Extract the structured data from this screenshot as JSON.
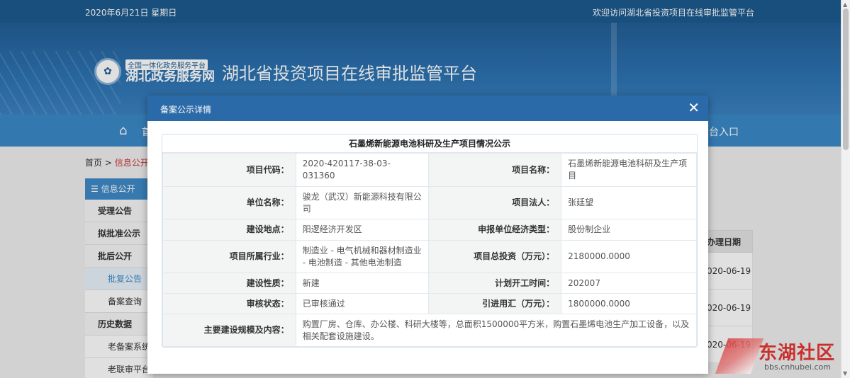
{
  "topbar": {
    "date": "2020年6月21日   星期日",
    "welcome": "欢迎访问湖北省投资项目在线审批监管平台"
  },
  "banner": {
    "gov_small": "全国一体化政务服务平台",
    "gov_big": "湖北政务服务网",
    "site_title": "湖北省投资项目在线审批监管平台"
  },
  "nav": {
    "home_icon": "home-icon",
    "home_text": "首",
    "entry_text": "台入口"
  },
  "breadcrumb": {
    "home": "首页",
    "sep": " > ",
    "current": "信息公开"
  },
  "sidebar": {
    "header": "信息公开",
    "items": [
      {
        "label": "受理公告"
      },
      {
        "label": "拟批准公示"
      },
      {
        "label": "批后公开"
      },
      {
        "label": "批复公告"
      },
      {
        "label": "备案查询"
      },
      {
        "label": "历史数据"
      },
      {
        "label": "老备案系统"
      },
      {
        "label": "老联审平台"
      }
    ]
  },
  "right_table": {
    "header": "办理日期",
    "rows": [
      "020-06-19",
      "020-06-19",
      "020-06-19"
    ]
  },
  "modal": {
    "title": "备案公示详情",
    "close_icon": "close-icon",
    "table_title": "石墨烯新能源电池科研及生产项目情况公示",
    "rows": [
      {
        "l1": "项目代码：",
        "v1": "2020-420117-38-03-031360",
        "l2": "项目名称：",
        "v2": "石墨烯新能源电池科研及生产项目"
      },
      {
        "l1": "单位名称：",
        "v1": "骏龙（武汉）新能源科技有限公司",
        "l2": "项目法人：",
        "v2": "张廷望"
      },
      {
        "l1": "建设地点：",
        "v1": "阳逻经济开发区",
        "l2": "申报单位经济类型：",
        "v2": "股份制企业"
      },
      {
        "l1": "项目所属行业：",
        "v1": "制造业 - 电气机械和器材制造业 - 电池制造 - 其他电池制造",
        "l2": "项目总投资（万元）：",
        "v2": "2180000.0000"
      },
      {
        "l1": "建设性质：",
        "v1": "新建",
        "l2": "计划开工时间：",
        "v2": "202007"
      },
      {
        "l1": "审核状态：",
        "v1": "已审核通过",
        "l2": "引进用汇（万元）：",
        "v2": "1800000.0000"
      }
    ],
    "scope_label": "主要建设规模及内容：",
    "scope_value": "购置厂房、仓库、办公楼、科研大楼等，总面积1500000平方米，购置石墨烯电池生产加工设备，以及相关配套设施建设。"
  },
  "watermark": {
    "big": "东湖社区",
    "small": "bbs.cnhubei.com"
  }
}
